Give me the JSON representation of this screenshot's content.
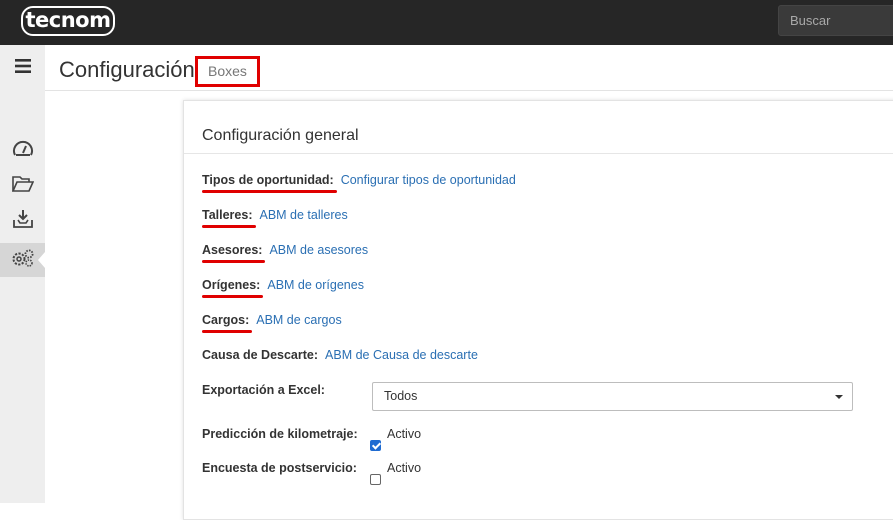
{
  "app": {
    "logo_text": "tecnom"
  },
  "search": {
    "placeholder": "Buscar"
  },
  "sidebar": {
    "items": [
      {
        "icon": "menu-icon"
      },
      {
        "icon": "dashboard-gauge-icon"
      },
      {
        "icon": "folder-open-icon"
      },
      {
        "icon": "inbox-download-icon"
      },
      {
        "icon": "gears-icon",
        "active": true
      }
    ]
  },
  "header": {
    "title": "Configuración",
    "subtitle": "Boxes"
  },
  "panel": {
    "title": "Configuración general",
    "rows": [
      {
        "label": "Tipos de oportunidad:",
        "link": "Configurar tipos de oportunidad"
      },
      {
        "label": "Talleres:",
        "link": "ABM de talleres"
      },
      {
        "label": "Asesores:",
        "link": "ABM de asesores"
      },
      {
        "label": "Orígenes:",
        "link": "ABM de orígenes"
      },
      {
        "label": "Cargos:",
        "link": "ABM de cargos"
      },
      {
        "label": "Causa de Descarte:",
        "link": "ABM de Causa de descarte"
      }
    ],
    "export": {
      "label": "Exportación a Excel:",
      "selected": "Todos"
    },
    "km_prediction": {
      "label": "Predicción de kilometraje:",
      "option": "Activo",
      "checked": true
    },
    "survey": {
      "label": "Encuesta de postservicio:",
      "option": "Activo",
      "checked": false
    }
  },
  "colors": {
    "topbar": "#262626",
    "link": "#2a6fb3",
    "annotation": "#e00000",
    "checkbox": "#1f6bd1"
  }
}
